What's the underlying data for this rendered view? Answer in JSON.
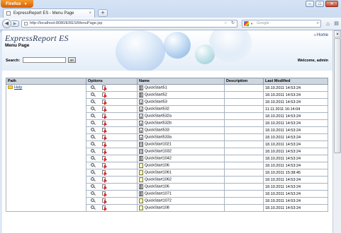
{
  "browser": {
    "app_button": "Firefox",
    "tab_title": "ExpressReport ES - Menu Page",
    "new_tab": "+",
    "url": "http://localhost:8080/ERES/MenuPage.jsp",
    "search_placeholder": "Google"
  },
  "page": {
    "logo": "ExpressReport ES",
    "title": "Menu Page",
    "home_link": "Home",
    "search_label": "Search:",
    "search_value": "",
    "go_button": "go",
    "welcome": "Welcome, admin"
  },
  "table": {
    "headers": [
      "Path",
      "Options",
      "Name",
      "Description",
      "Last Modified"
    ],
    "folder": "Help",
    "rows": [
      {
        "name": "QuickStart51",
        "description": "",
        "modified": "18.10.2011 14:53:24",
        "icon": "chart-icon"
      },
      {
        "name": "QuickStart52",
        "description": "",
        "modified": "18.10.2011 14:53:24",
        "icon": "chart-icon"
      },
      {
        "name": "QuickStart53",
        "description": "",
        "modified": "18.10.2011 14:53:24",
        "icon": "document-icon"
      },
      {
        "name": "QuickStart532",
        "description": "",
        "modified": "11.11.2011 16:14:04",
        "icon": "document-icon"
      },
      {
        "name": "QuickStart532a",
        "description": "",
        "modified": "18.10.2011 14:53:24",
        "icon": "document-icon"
      },
      {
        "name": "QuickStart532b",
        "description": "",
        "modified": "18.10.2011 14:53:24",
        "icon": "document-icon"
      },
      {
        "name": "QuickStart533",
        "description": "",
        "modified": "18.10.2011 14:53:24",
        "icon": "document-icon"
      },
      {
        "name": "QuickStart533a",
        "description": "",
        "modified": "18.10.2011 14:53:24",
        "icon": "document-icon"
      },
      {
        "name": "QuickStart1021",
        "description": "",
        "modified": "18.10.2011 14:53:24",
        "icon": "table-icon"
      },
      {
        "name": "QuickStart1032",
        "description": "",
        "modified": "18.10.2011 14:53:24",
        "icon": "table-icon"
      },
      {
        "name": "QuickStart1042",
        "description": "",
        "modified": "18.10.2011 14:53:24",
        "icon": "chart-icon"
      },
      {
        "name": "QuickStart106",
        "description": "",
        "modified": "18.10.2011 14:53:24",
        "icon": "star-report-icon"
      },
      {
        "name": "QuickStart1061",
        "description": "",
        "modified": "18.10.2011 15:38:45",
        "icon": "star-report-icon"
      },
      {
        "name": "QuickStart1062",
        "description": "",
        "modified": "18.10.2011 14:53:24",
        "icon": "star-report-icon"
      },
      {
        "name": "QuickStart106",
        "description": "",
        "modified": "18.10.2011 14:53:24",
        "icon": "chart-icon"
      },
      {
        "name": "QuickStart1071",
        "description": "",
        "modified": "18.10.2011 14:53:24",
        "icon": "chart-icon"
      },
      {
        "name": "QuickStart1072",
        "description": "",
        "modified": "18.10.2011 14:53:24",
        "icon": "star-report-icon"
      },
      {
        "name": "QuickStart108",
        "description": "",
        "modified": "18.10.2011 14:53:24",
        "icon": "star-report-icon"
      }
    ]
  }
}
